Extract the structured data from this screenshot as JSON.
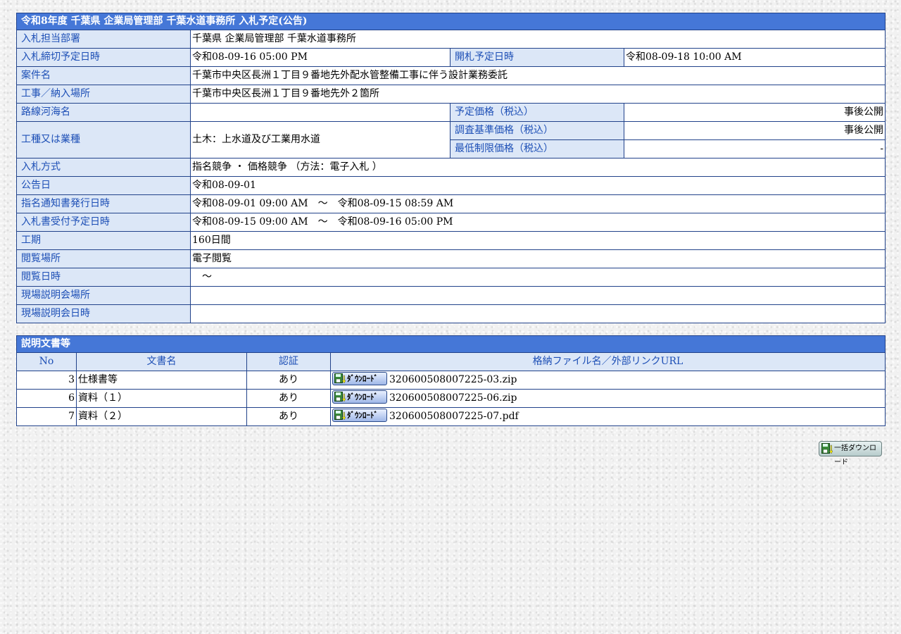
{
  "info": {
    "title": "令和8年度 千葉県 企業局管理部 千葉水道事務所 入札予定(公告)",
    "rows": {
      "dept_label": "入札担当部署",
      "dept_value": "千葉県 企業局管理部 千葉水道事務所",
      "deadline_label": "入札締切予定日時",
      "deadline_value": "令和08-09-16 05:00 PM",
      "open_label": "開札予定日時",
      "open_value": "令和08-09-18 10:00 AM",
      "case_label": "案件名",
      "case_value": "千葉市中央区長洲１丁目９番地先外配水管整備工事に伴う設計業務委託",
      "place_label": "工事／納入場所",
      "place_value": "千葉市中央区長洲１丁目９番地先外２箇所",
      "route_label": "路線河海名",
      "route_value": "",
      "planned_price_label": "予定価格（税込）",
      "planned_price_value": "事後公開",
      "type_label": "工種又は業種",
      "type_value": "土木：上水道及び工業用水道",
      "survey_price_label": "調査基準価格（税込）",
      "survey_price_value": "事後公開",
      "min_price_label": "最低制限価格（税込）",
      "min_price_value": "-",
      "method_label": "入札方式",
      "method_value": "指名競争 ・ 価格競争 （方法：電子入札 ）",
      "notice_date_label": "公告日",
      "notice_date_value": "令和08-09-01",
      "issue_label": "指名通知書発行日時",
      "issue_value": "令和08-09-01 09:00 AM　～　令和08-09-15 08:59 AM",
      "receipt_label": "入札書受付予定日時",
      "receipt_value": "令和08-09-15 09:00 AM　～　令和08-09-16 05:00 PM",
      "period_label": "工期",
      "period_value": "160日間",
      "view_place_label": "閲覧場所",
      "view_place_value": "電子閲覧",
      "view_date_label": "閲覧日時",
      "view_date_value": "　～",
      "site_place_label": "現場説明会場所",
      "site_place_value": "",
      "site_date_label": "現場説明会日時",
      "site_date_value": ""
    }
  },
  "docs": {
    "title": "説明文書等",
    "headers": [
      "No",
      "文書名",
      "認証",
      "格納ファイル名／外部リンクURL"
    ],
    "download_label": "ﾀﾞｳﾝﾛｰﾄﾞ",
    "rows": [
      {
        "no": "3",
        "name": "仕様書等",
        "auth": "あり",
        "file": "320600508007225-03.zip"
      },
      {
        "no": "6",
        "name": "資料（１）",
        "auth": "あり",
        "file": "320600508007225-06.zip"
      },
      {
        "no": "7",
        "name": "資料（２）",
        "auth": "あり",
        "file": "320600508007225-07.pdf"
      }
    ]
  },
  "bulk_download_label": "一括ダウンロード",
  "colors": {
    "title_bg": "#4577d7",
    "label_bg": "#dce7f7",
    "label_text": "#1d4fb6",
    "border": "#21428a"
  },
  "icons": {
    "download": "floppy-download-icon"
  }
}
